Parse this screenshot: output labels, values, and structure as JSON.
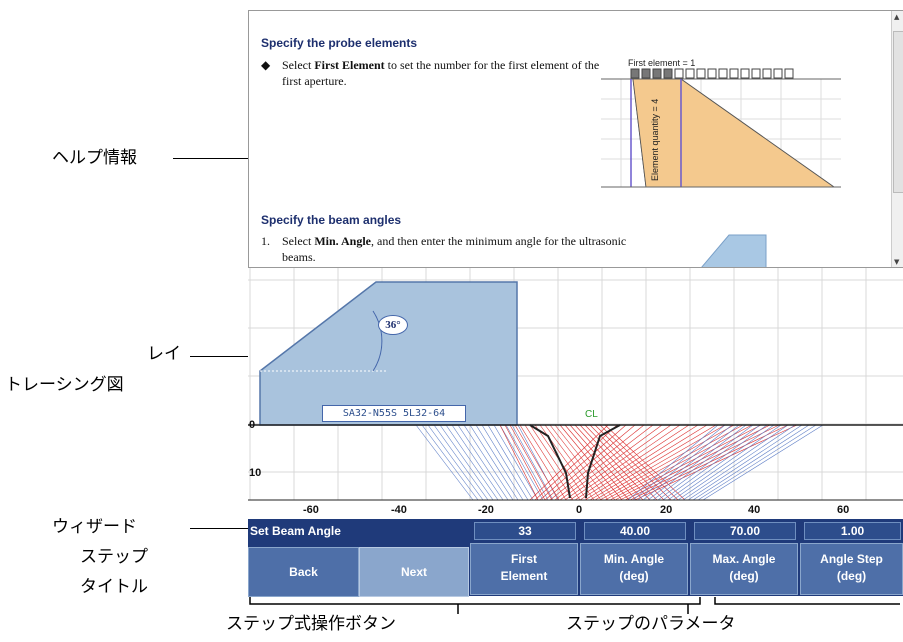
{
  "callouts": {
    "help_info": "ヘルプ情報",
    "ray_tracing_line1": "レイ",
    "ray_tracing_line2": "トレーシング図",
    "wizard_title_line1": "ウィザード",
    "wizard_title_line2": "ステップ",
    "wizard_title_line3": "タイトル",
    "step_buttons": "ステップ式操作ボタン",
    "step_params": "ステップのパラメータ"
  },
  "help": {
    "section1_title": "Specify the probe elements",
    "section1_prefix": "Select ",
    "section1_bold": "First Element",
    "section1_rest": " to set the number for the first element of the first aperture.",
    "figure_first_element": "First element = 1",
    "figure_element_quantity": "Element quantity = 4",
    "section2_title": "Specify the beam angles",
    "section2_num": "1.",
    "section2_prefix": "Select ",
    "section2_bold": "Min. Angle",
    "section2_rest": ", and then enter the minimum angle for the ultrasonic beams."
  },
  "ray_tracing": {
    "wedge_angle": "36°",
    "probe_label": "SA32-N55S 5L32-64",
    "cl_label": "CL",
    "depth_labels": [
      "0",
      "10"
    ],
    "x_axis_labels": [
      "-60",
      "-40",
      "-20",
      "0",
      "20",
      "40",
      "60"
    ]
  },
  "wizard": {
    "step_title": "Set Beam Angle",
    "back_label": "Back",
    "next_label": "Next",
    "params": [
      {
        "value": "33",
        "label1": "First",
        "label2": "Element"
      },
      {
        "value": "40.00",
        "label1": "Min. Angle",
        "label2": "(deg)"
      },
      {
        "value": "70.00",
        "label1": "Max. Angle",
        "label2": "(deg)"
      },
      {
        "value": "1.00",
        "label1": "Angle Step",
        "label2": "(deg)"
      }
    ]
  },
  "colors": {
    "panel_bg": "#1f3a7a",
    "button_bg": "#4e6fa8",
    "next_bg": "#8aa6cc",
    "param_value_bg": "#2d4d8c",
    "wedge_fill": "#a9c3dd",
    "help_title": "#1d2f6e"
  }
}
